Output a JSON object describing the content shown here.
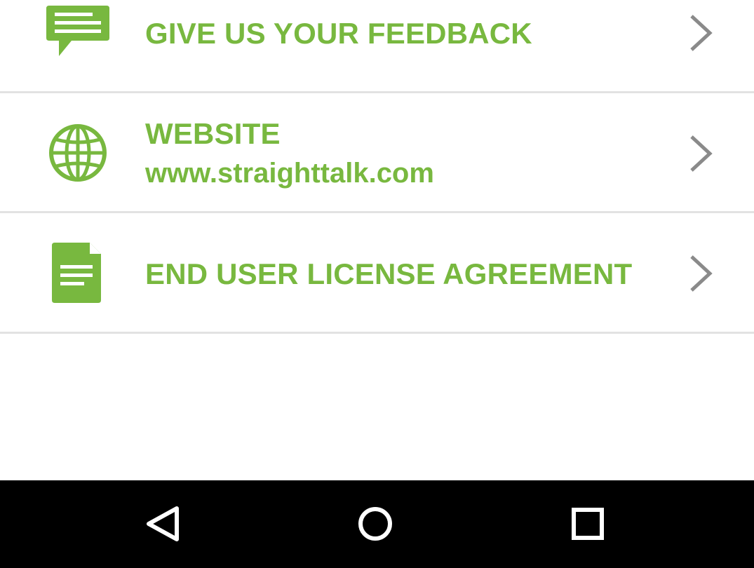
{
  "colors": {
    "accent_green": "#78b83f",
    "chevron_gray": "#8a8a8a",
    "divider": "#e2e2e2",
    "navbar_bg": "#000000",
    "navbar_icon": "#ffffff"
  },
  "menu": {
    "items": [
      {
        "icon": "chat-bubble-icon",
        "label": "GIVE US YOUR FEEDBACK",
        "chevron": "chevron-right-icon"
      },
      {
        "icon": "globe-icon",
        "label": "WEBSITE",
        "sublabel": "www.straighttalk.com",
        "chevron": "chevron-right-icon"
      },
      {
        "icon": "document-icon",
        "label": "END USER LICENSE AGREEMENT",
        "chevron": "chevron-right-icon"
      }
    ]
  },
  "navbar": {
    "buttons": [
      {
        "icon": "back-triangle-icon"
      },
      {
        "icon": "home-circle-icon"
      },
      {
        "icon": "recents-square-icon"
      }
    ]
  }
}
